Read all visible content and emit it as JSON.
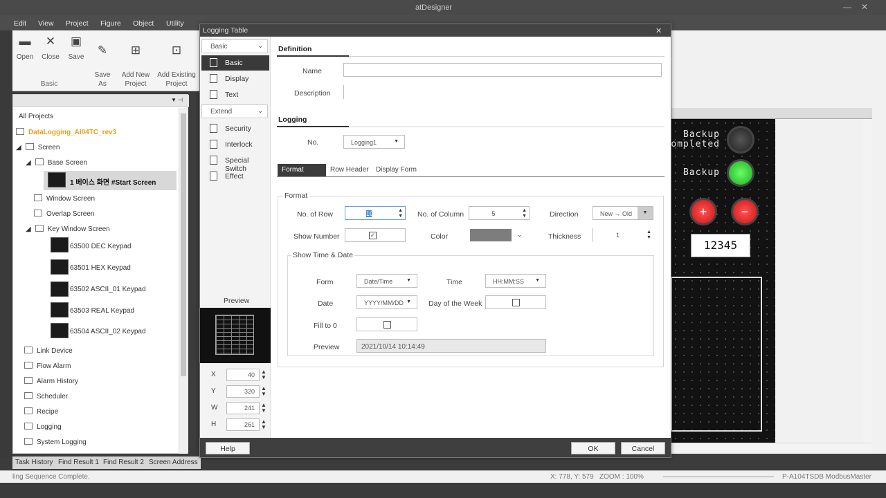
{
  "app": {
    "title": "atDesigner",
    "window_controls": [
      "—",
      "✕"
    ]
  },
  "menu": [
    "Edit",
    "View",
    "Project",
    "Figure",
    "Object",
    "Utility"
  ],
  "ribbon": {
    "buttons": [
      {
        "label": "Open",
        "icon": "open-folder-icon",
        "glyph": "▬"
      },
      {
        "label": "Close",
        "icon": "close-icon",
        "glyph": "✕"
      },
      {
        "label": "Save",
        "icon": "save-icon",
        "glyph": "▣"
      },
      {
        "label": "Save\nAs",
        "icon": "save-as-icon",
        "glyph": "✎"
      },
      {
        "label": "Add New\nProject",
        "icon": "add-new-project-icon",
        "glyph": "⊞"
      },
      {
        "label": "Add Existing\nProject",
        "icon": "add-existing-project-icon",
        "glyph": "⊡"
      }
    ],
    "group": "Basic"
  },
  "project_tree": {
    "root": "All Projects",
    "project": "DataLogging_AI04TC_rev3",
    "items": [
      {
        "label": "Screen"
      },
      {
        "label": "Base Screen"
      },
      {
        "label": "1 베이스 화면 #Start Screen"
      },
      {
        "label": "Window Screen"
      },
      {
        "label": "Overlap Screen"
      },
      {
        "label": "Key Window Screen"
      },
      {
        "label": "63500 DEC Keypad"
      },
      {
        "label": "63501 HEX Keypad"
      },
      {
        "label": "63502 ASCII_01 Keypad"
      },
      {
        "label": "63503 REAL Keypad"
      },
      {
        "label": "63504 ASCII_02 Keypad"
      },
      {
        "label": "Link Device"
      },
      {
        "label": "Flow Alarm"
      },
      {
        "label": "Alarm History"
      },
      {
        "label": "Scheduler"
      },
      {
        "label": "Recipe"
      },
      {
        "label": "Logging"
      },
      {
        "label": "System Logging"
      }
    ]
  },
  "bottom_tabs": [
    "Task History",
    "Find Result 1",
    "Find Result 2",
    "Screen Address"
  ],
  "status": {
    "message": "ling Sequence Complete.",
    "coords": "X: 778, Y: 579",
    "zoom": "ZOOM : 100%",
    "device": "P-A104TSDB  ModbusMaster"
  },
  "canvas": {
    "lamp1_label": "Backup\ncompleted",
    "lamp2_label": "Backup",
    "plus": "+",
    "minus": "−",
    "numeric": "12345"
  },
  "dialog": {
    "title": "Logging Table",
    "close": "✕",
    "nav": {
      "basic_section": "Basic",
      "basic_items": [
        "Basic",
        "Display",
        "Text"
      ],
      "extend_section": "Extend",
      "extend_items": [
        "Security",
        "Interlock",
        "Special Switch",
        "Effect"
      ],
      "preview_label": "Preview",
      "pos": [
        {
          "label": "X",
          "value": "40"
        },
        {
          "label": "Y",
          "value": "320"
        },
        {
          "label": "W",
          "value": "241"
        },
        {
          "label": "H",
          "value": "261"
        }
      ]
    },
    "definition": {
      "heading": "Definition",
      "name_label": "Name",
      "name_value": "",
      "desc_label": "Description",
      "desc_value": ""
    },
    "logging": {
      "heading": "Logging",
      "no_label": "No.",
      "no_value": "Logging1"
    },
    "tabs": [
      "Format",
      "Row Header",
      "Display Form"
    ],
    "format": {
      "group": "Format",
      "rows_label": "No. of Row",
      "rows_value": "10",
      "cols_label": "No. of Column",
      "cols_value": "5",
      "direction_label": "Direction",
      "direction_value": "New → Old",
      "show_number_label": "Show Number",
      "show_number_checked": "✓",
      "color_label": "Color",
      "color_value": "#7d7d7d",
      "thickness_label": "Thickness",
      "thickness_value": "1"
    },
    "time_date": {
      "group": "Show Time & Date",
      "form_label": "Form",
      "form_value": "Date/Time",
      "time_label": "Time",
      "time_value": "HH:MM:SS",
      "date_label": "Date",
      "date_value": "YYYY/MM/DD",
      "dow_label": "Day of the Week",
      "fill_label": "Fill to 0",
      "preview_label": "Preview",
      "preview_value": "2021/10/14 10:14:49"
    },
    "buttons": {
      "help": "Help",
      "ok": "OK",
      "cancel": "Cancel"
    }
  }
}
